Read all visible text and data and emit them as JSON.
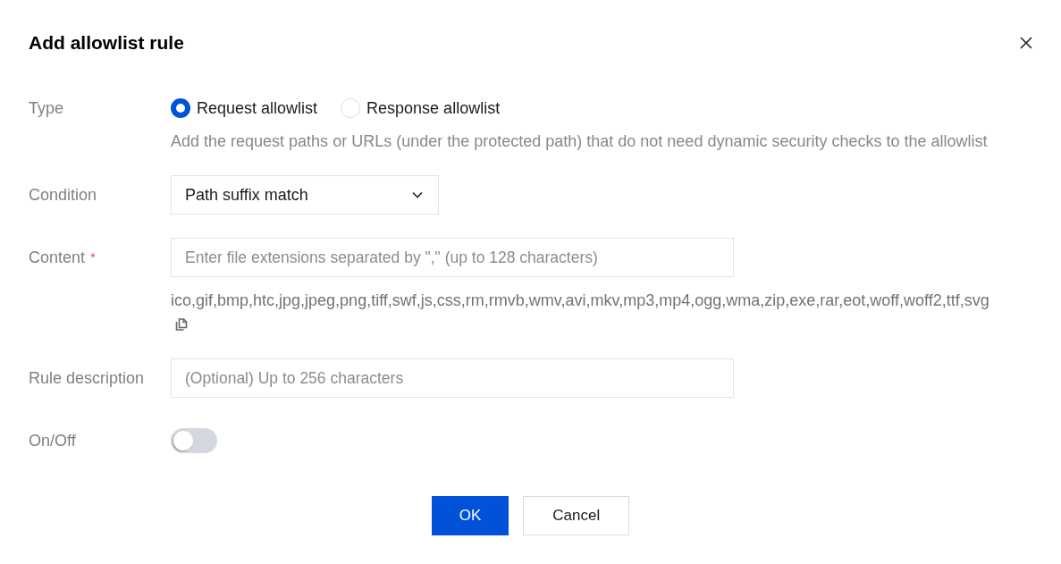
{
  "dialog": {
    "title": "Add allowlist rule"
  },
  "fields": [
    {
      "kind": "radio",
      "label": "Type",
      "options": [
        {
          "label": "Request allowlist",
          "selected": true
        },
        {
          "label": "Response allowlist",
          "selected": false
        }
      ],
      "hint": "Add the request paths or URLs (under the protected path) that do not need dynamic security checks to the allowlist"
    },
    {
      "kind": "select",
      "label": "Condition",
      "value": "Path suffix match"
    },
    {
      "kind": "input",
      "label": "Content",
      "required_mark": "*",
      "placeholder": "Enter file extensions separated by \",\" (up to 128 characters)",
      "note": "ico,gif,bmp,htc,jpg,jpeg,png,tiff,swf,js,css,rm,rmvb,wmv,avi,mkv,mp3,mp4,ogg,wma,zip,exe,rar,eot,woff,woff2,ttf,svg",
      "copyable": true
    },
    {
      "kind": "input",
      "label": "Rule description",
      "placeholder": "(Optional) Up to 256 characters"
    },
    {
      "kind": "switch",
      "label": "On/Off",
      "on": false
    }
  ],
  "buttons": [
    {
      "label": "OK",
      "kind": "primary"
    },
    {
      "label": "Cancel",
      "kind": "secondary"
    }
  ]
}
